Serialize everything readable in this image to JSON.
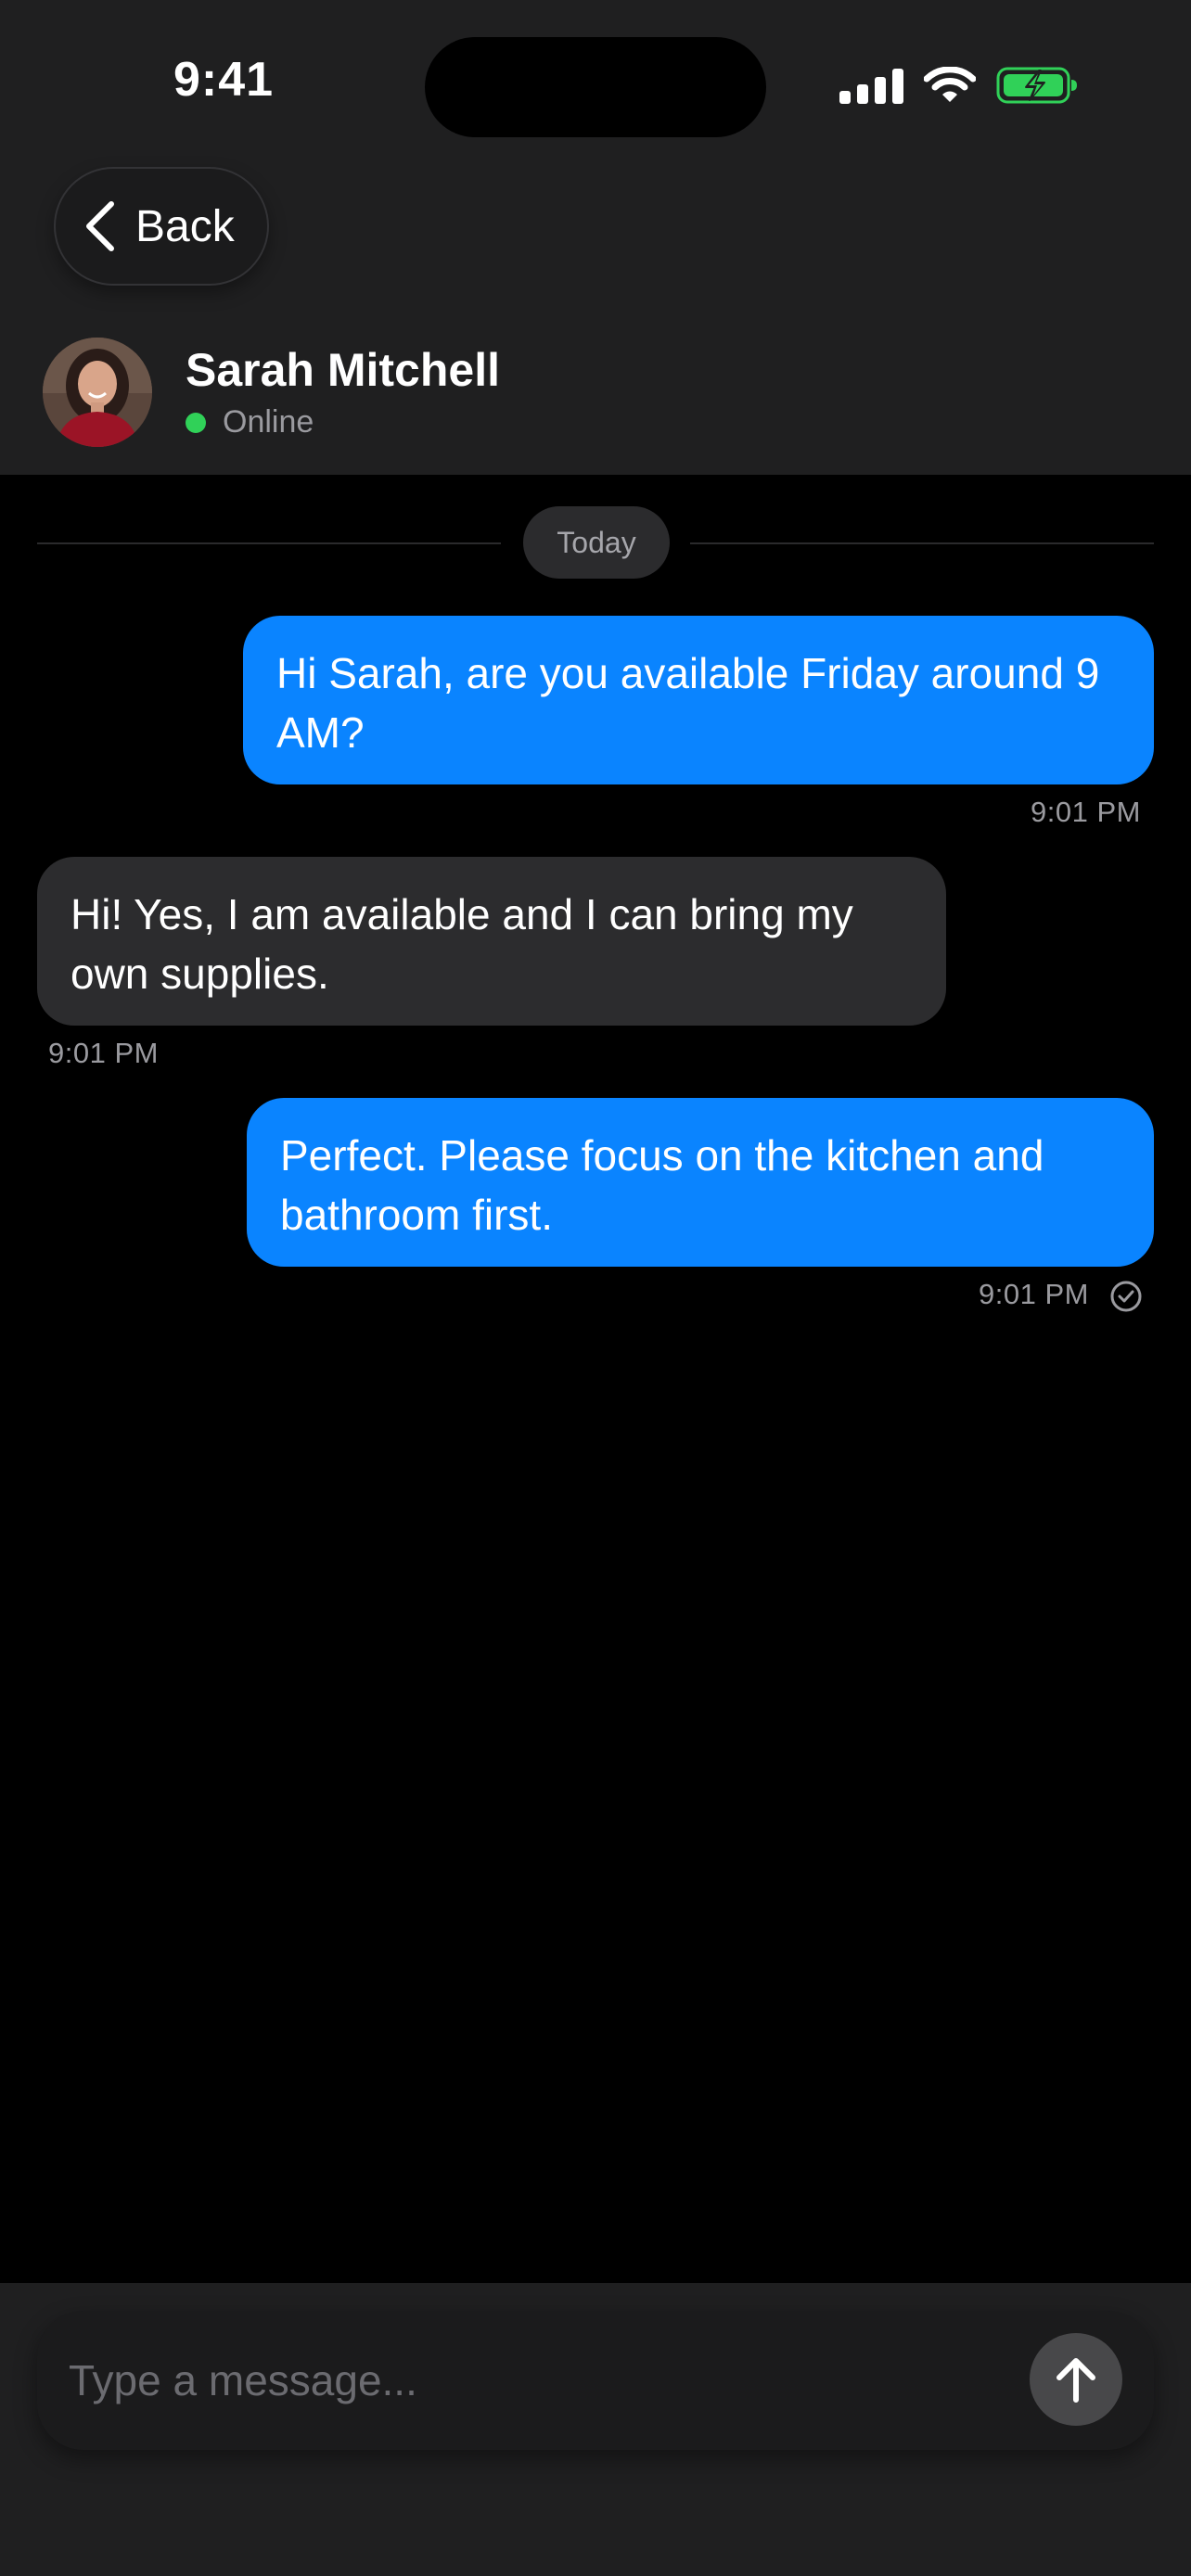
{
  "status_bar": {
    "time": "9:41",
    "icons": [
      "cellular-signal-icon",
      "wifi-icon",
      "battery-charging-icon"
    ],
    "battery_color": "#30d158"
  },
  "header": {
    "back_label": "Back",
    "contact": {
      "name": "Sarah Mitchell",
      "status": "Online",
      "status_color": "#30d158"
    }
  },
  "conversation": {
    "date_label": "Today",
    "messages": [
      {
        "direction": "outgoing",
        "text": "Hi Sarah, are you available Friday around 9 AM?",
        "time": "9:01 PM"
      },
      {
        "direction": "incoming",
        "text": "Hi! Yes, I am available and I can bring my own supplies.",
        "time": "9:01 PM"
      },
      {
        "direction": "outgoing",
        "text": "Perfect. Please focus on the kitchen and bathroom first.",
        "time": "9:01 PM",
        "receipt_icon": "read-checkmark-icon"
      }
    ]
  },
  "composer": {
    "placeholder": "Type a message...",
    "send_icon": "arrow-up-icon"
  },
  "colors": {
    "outgoing_bubble": "#0a84ff",
    "incoming_bubble": "#2c2c2e",
    "header_background": "#1f1f20",
    "chat_background": "#000000"
  }
}
